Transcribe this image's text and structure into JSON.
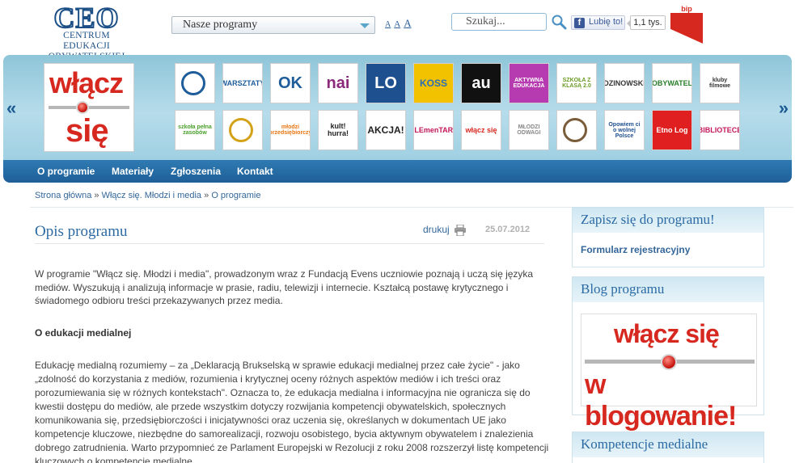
{
  "header": {
    "logo_mark": "CEO",
    "logo_line1": "CENTRUM EDUKACJI",
    "logo_line2": "OBYWATELSKIEJ",
    "program_select": "Nasze programy",
    "font_sizes": [
      "A",
      "A",
      "A"
    ],
    "search_placeholder": "Szukaj...",
    "fb_like": "Lubię to!",
    "fb_count": "1,1 tys.",
    "bip": "bip"
  },
  "banner": {
    "main_logo_line1": "włącz",
    "main_logo_line2": "się",
    "tiles": [
      {
        "label": "",
        "icon": "plane-badge-icon",
        "bg": "#ffffff",
        "fg": "#1e5c9a"
      },
      {
        "label": "WARSZTATY",
        "icon": "school-building-icon",
        "bg": "#ffffff",
        "fg": "#1e5c9a"
      },
      {
        "label": "OK",
        "icon": "ok-badge-icon",
        "bg": "#ffffff",
        "fg": "#1e5c9a"
      },
      {
        "label": "nai",
        "icon": "nai-logo-icon",
        "bg": "#ffffff",
        "fg": "#8c2a7a"
      },
      {
        "label": "LO",
        "icon": "lo-logo-icon",
        "bg": "#1e4f8f",
        "fg": "#ffffff"
      },
      {
        "label": "KOSS",
        "icon": "koss-logo-icon",
        "bg": "#f2c200",
        "fg": "#2a6fb5"
      },
      {
        "label": "au",
        "icon": "au-logo-icon",
        "bg": "#111111",
        "fg": "#ffffff"
      },
      {
        "label": "AKTYWNA EDUKACJA",
        "icon": "play-arrow-icon",
        "bg": "#b63bb0",
        "fg": "#ffffff"
      },
      {
        "label": "SZKOŁA Z KLASĄ 2.0",
        "icon": "szkola-z-klasa-icon",
        "bg": "#ffffff",
        "fg": "#6a9b23"
      },
      {
        "label": "DZINOWSKI",
        "icon": "snowflake-icon",
        "bg": "#ffffff",
        "fg": "#333333"
      },
      {
        "label": "OBYWATEL",
        "icon": "obywatel-icon",
        "bg": "#ffffff",
        "fg": "#2a7d2a"
      },
      {
        "label": "kluby filmowe",
        "icon": "film-club-icon",
        "bg": "#ffffff",
        "fg": "#333333"
      },
      {
        "label": "szkoła pełna zasobów",
        "icon": "faucet-icon",
        "bg": "#ffffff",
        "fg": "#4aa02c"
      },
      {
        "label": "",
        "icon": "globe-icon",
        "bg": "#ffffff",
        "fg": "#d4a21a"
      },
      {
        "label": "młodzi przedsiębiorczy",
        "icon": "m-logo-icon",
        "bg": "#ffffff",
        "fg": "#e87511"
      },
      {
        "label": "kult! hurra!",
        "icon": "kult-hurra-icon",
        "bg": "#ffffff",
        "fg": "#222222"
      },
      {
        "label": "AKCJA!",
        "icon": "camera-icon",
        "bg": "#ffffff",
        "fg": "#222222"
      },
      {
        "label": "ELEmenTARZ",
        "icon": "elementarz-icon",
        "bg": "#ffffff",
        "fg": "#c2185b"
      },
      {
        "label": "włącz się",
        "icon": "wlacz-sie-small-icon",
        "bg": "#ffffff",
        "fg": "#d7281f"
      },
      {
        "label": "MŁODZI ODWAGI",
        "icon": "mlodzi-odwagi-icon",
        "bg": "#ffffff",
        "fg": "#888888"
      },
      {
        "label": "",
        "icon": "emblem-icon",
        "bg": "#ffffff",
        "fg": "#7a5c3a"
      },
      {
        "label": "Opowiem ci o wolnej Polsce",
        "icon": "opowiem-ci-icon",
        "bg": "#ffffff",
        "fg": "#1e4f8f"
      },
      {
        "label": "Etno Log",
        "icon": "etnolog-icon",
        "bg": "#e02020",
        "fg": "#ffffff"
      },
      {
        "label": "BIBLIOTECE",
        "icon": "biblioteka-icon",
        "bg": "#ffffff",
        "fg": "#c2185b"
      }
    ]
  },
  "menu": {
    "items": [
      "O programie",
      "Materiały",
      "Zgłoszenia",
      "Kontakt"
    ]
  },
  "breadcrumb": {
    "items": [
      "Strona główna",
      "Włącz się. Młodzi i media",
      "O programie"
    ],
    "separator": "»"
  },
  "content": {
    "title": "Opis programu",
    "print": "drukuj",
    "date": "25.07.2012",
    "intro": "W programie \"Włącz się. Młodzi i media\", prowadzonym wraz z Fundacją Evens uczniowie poznają i uczą się języka mediów. Wyszukują i analizują informacje w prasie, radiu, telewizji i internecie. Kształcą postawę krytycznego i świadomego odbioru treści przekazywanych przez media.",
    "subhead": "O edukacji medialnej",
    "para2": "Edukację medialną rozumiemy – za „Deklaracją Brukselską w sprawie edukacji medialnej przez całe życie\" - jako „zdolność do korzystania z mediów, rozumienia i krytycznej oceny różnych aspektów mediów i ich treści oraz porozumiewania się w różnych kontekstach\". Oznacza to, że edukacja medialna i informacyjna nie ogranicza się do kwestii dostępu do mediów, ale przede wszystkim dotyczy rozwijania kompetencji obywatelskich, społecznych komunikowania się, przedsiębiorczości i inicjatywności oraz uczenia się, określanych w dokumentach UE jako kompetencje kluczowe, niezbędne do samorealizacji, rozwoju osobistego, bycia aktywnym obywatelem i znalezienia dobrego zatrudnienia. Warto przypomnieć ze Parlament Europejski w Rezolucji z roku 2008 rozszerzył listę kompetencji kluczowych o kompetencje medialne."
  },
  "sidebar": {
    "box1_title": "Zapisz się do programu!",
    "box1_link": "Formularz rejestracyjny",
    "box2_title": "Blog programu",
    "blog_line1": "włącz się",
    "blog_line2": "w blogowanie!",
    "box3_title": "Kompetencje medialne"
  },
  "colors": {
    "accent": "#2b6aa4",
    "menu": "#1f5f98",
    "banner": "#a9d6e8",
    "brand_red": "#d7281f"
  }
}
